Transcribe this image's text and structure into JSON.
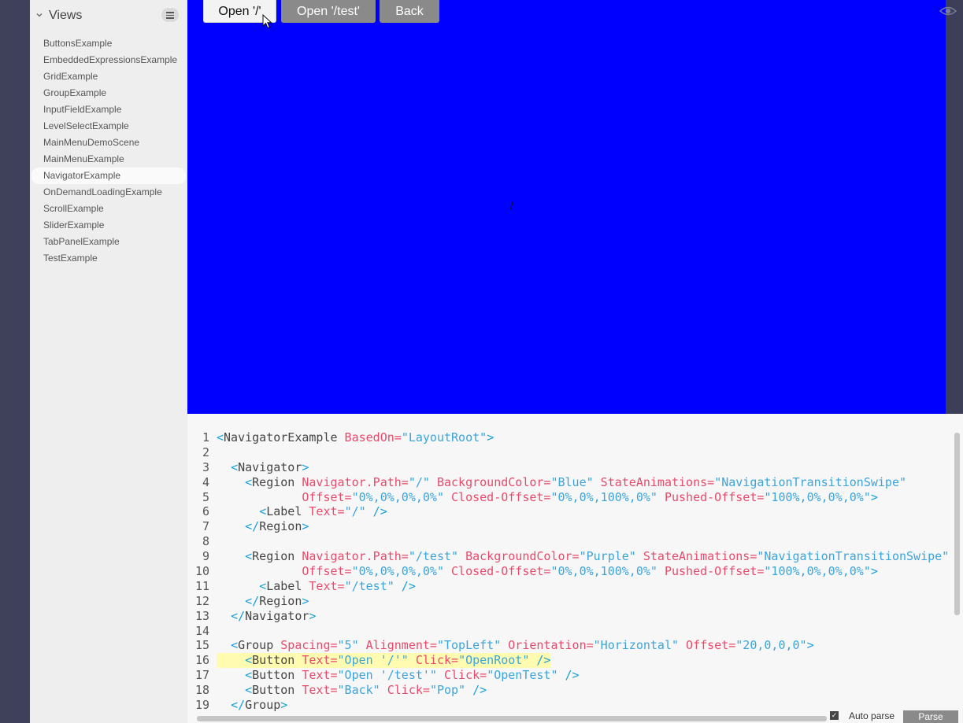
{
  "sidebar": {
    "title": "Views",
    "items": [
      {
        "label": "ButtonsExample"
      },
      {
        "label": "EmbeddedExpressionsExample"
      },
      {
        "label": "GridExample"
      },
      {
        "label": "GroupExample"
      },
      {
        "label": "InputFieldExample"
      },
      {
        "label": "LevelSelectExample"
      },
      {
        "label": "MainMenuDemoScene"
      },
      {
        "label": "MainMenuExample"
      },
      {
        "label": "NavigatorExample",
        "selected": true
      },
      {
        "label": "OnDemandLoadingExample"
      },
      {
        "label": "ScrollExample"
      },
      {
        "label": "SliderExample"
      },
      {
        "label": "TabPanelExample"
      },
      {
        "label": "TestExample"
      }
    ]
  },
  "preview": {
    "background": "#0000ff",
    "buttons": {
      "open_root": "Open '/'",
      "open_test": "Open '/test'",
      "back": "Back"
    },
    "label": "/"
  },
  "editor": {
    "highlight_line": 16,
    "lines": [
      [
        [
          "p",
          "<"
        ],
        [
          "t",
          "NavigatorExample"
        ],
        [
          "a",
          " BasedOn="
        ],
        [
          "v",
          "\"LayoutRoot\""
        ],
        [
          "p",
          ">"
        ]
      ],
      [],
      [
        [
          "t",
          "  "
        ],
        [
          "p",
          "<"
        ],
        [
          "t",
          "Navigator"
        ],
        [
          "p",
          ">"
        ]
      ],
      [
        [
          "t",
          "    "
        ],
        [
          "p",
          "<"
        ],
        [
          "t",
          "Region"
        ],
        [
          "a",
          " Navigator.Path="
        ],
        [
          "v",
          "\"/\""
        ],
        [
          "a",
          " BackgroundColor="
        ],
        [
          "v",
          "\"Blue\""
        ],
        [
          "a",
          " StateAnimations="
        ],
        [
          "v",
          "\"NavigationTransitionSwipe\""
        ]
      ],
      [
        [
          "t",
          "            "
        ],
        [
          "a",
          "Offset="
        ],
        [
          "v",
          "\"0%,0%,0%,0%\""
        ],
        [
          "a",
          " Closed-Offset="
        ],
        [
          "v",
          "\"0%,0%,100%,0%\""
        ],
        [
          "a",
          " Pushed-Offset="
        ],
        [
          "v",
          "\"100%,0%,0%,0%\""
        ],
        [
          "p",
          ">"
        ]
      ],
      [
        [
          "t",
          "      "
        ],
        [
          "p",
          "<"
        ],
        [
          "t",
          "Label"
        ],
        [
          "a",
          " Text="
        ],
        [
          "v",
          "\"/\""
        ],
        [
          "p",
          " />"
        ]
      ],
      [
        [
          "t",
          "    "
        ],
        [
          "p",
          "</"
        ],
        [
          "t",
          "Region"
        ],
        [
          "p",
          ">"
        ]
      ],
      [],
      [
        [
          "t",
          "    "
        ],
        [
          "p",
          "<"
        ],
        [
          "t",
          "Region"
        ],
        [
          "a",
          " Navigator.Path="
        ],
        [
          "v",
          "\"/test\""
        ],
        [
          "a",
          " BackgroundColor="
        ],
        [
          "v",
          "\"Purple\""
        ],
        [
          "a",
          " StateAnimations="
        ],
        [
          "v",
          "\"NavigationTransitionSwipe\""
        ]
      ],
      [
        [
          "t",
          "            "
        ],
        [
          "a",
          "Offset="
        ],
        [
          "v",
          "\"0%,0%,0%,0%\""
        ],
        [
          "a",
          " Closed-Offset="
        ],
        [
          "v",
          "\"0%,0%,100%,0%\""
        ],
        [
          "a",
          " Pushed-Offset="
        ],
        [
          "v",
          "\"100%,0%,0%,0%\""
        ],
        [
          "p",
          ">"
        ]
      ],
      [
        [
          "t",
          "      "
        ],
        [
          "p",
          "<"
        ],
        [
          "t",
          "Label"
        ],
        [
          "a",
          " Text="
        ],
        [
          "v",
          "\"/test\""
        ],
        [
          "p",
          " />"
        ]
      ],
      [
        [
          "t",
          "    "
        ],
        [
          "p",
          "</"
        ],
        [
          "t",
          "Region"
        ],
        [
          "p",
          ">"
        ]
      ],
      [
        [
          "t",
          "  "
        ],
        [
          "p",
          "</"
        ],
        [
          "t",
          "Navigator"
        ],
        [
          "p",
          ">"
        ]
      ],
      [],
      [
        [
          "t",
          "  "
        ],
        [
          "p",
          "<"
        ],
        [
          "t",
          "Group"
        ],
        [
          "a",
          " Spacing="
        ],
        [
          "v",
          "\"5\""
        ],
        [
          "a",
          " Alignment="
        ],
        [
          "v",
          "\"TopLeft\""
        ],
        [
          "a",
          " Orientation="
        ],
        [
          "v",
          "\"Horizontal\""
        ],
        [
          "a",
          " Offset="
        ],
        [
          "v",
          "\"20,0,0,0\""
        ],
        [
          "p",
          ">"
        ]
      ],
      [
        [
          "t",
          "    "
        ],
        [
          "p",
          "<"
        ],
        [
          "t",
          "Button"
        ],
        [
          "a",
          " Text="
        ],
        [
          "v",
          "\"Open '/'\""
        ],
        [
          "a",
          " Click="
        ],
        [
          "v",
          "\"OpenRoot\""
        ],
        [
          "p",
          " />"
        ]
      ],
      [
        [
          "t",
          "    "
        ],
        [
          "p",
          "<"
        ],
        [
          "t",
          "Button"
        ],
        [
          "a",
          " Text="
        ],
        [
          "v",
          "\"Open '/test'\""
        ],
        [
          "a",
          " Click="
        ],
        [
          "v",
          "\"OpenTest\""
        ],
        [
          "p",
          " />"
        ]
      ],
      [
        [
          "t",
          "    "
        ],
        [
          "p",
          "<"
        ],
        [
          "t",
          "Button"
        ],
        [
          "a",
          " Text="
        ],
        [
          "v",
          "\"Back\""
        ],
        [
          "a",
          " Click="
        ],
        [
          "v",
          "\"Pop\""
        ],
        [
          "p",
          " />"
        ]
      ],
      [
        [
          "t",
          "  "
        ],
        [
          "p",
          "</"
        ],
        [
          "t",
          "Group"
        ],
        [
          "p",
          ">"
        ]
      ]
    ],
    "auto_parse": {
      "label": "Auto parse",
      "checked": true,
      "check_glyph": "✓"
    },
    "parse_button": "Parse"
  },
  "icons": {
    "views_chevron": "chevron-down-icon",
    "views_menu": "hamburger-menu-icon",
    "preview_toggle": "eye-icon",
    "cursor": "mouse-pointer-icon"
  }
}
